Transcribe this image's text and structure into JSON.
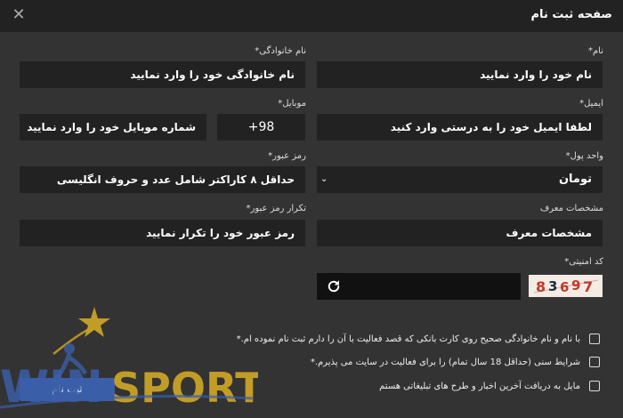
{
  "header": {
    "title": "صفحه ثبت نام",
    "close_icon": "close-icon"
  },
  "form": {
    "name": {
      "label": "نام*",
      "value": "نام خود را وارد نمایید"
    },
    "lastname": {
      "label": "نام خانوادگی*",
      "value": "نام خانوادگی خود را وارد نمایید"
    },
    "email": {
      "label": "ایمیل*",
      "value": "لطفا ایمیل خود را به درستی وارد کنید"
    },
    "mobile": {
      "label": "موبایل*",
      "code": "+98",
      "value": "شماره موبایل خود را وارد نمایید"
    },
    "currency": {
      "label": "واحد پول*",
      "value": "تومان"
    },
    "password": {
      "label": "رمز عبور*",
      "value": "حداقل ۸ کاراکتر شامل عدد و حروف انگلیسی"
    },
    "referrer": {
      "label": "مشخصات معرف",
      "value": "مشخصات معرف"
    },
    "password_confirm": {
      "label": "تکرار رمز عبور*",
      "value": "رمز عبور خود را تکرار نمایید"
    },
    "captcha": {
      "label": "کد امنیتی*",
      "code": "83697"
    }
  },
  "checkboxes": [
    "با نام و نام خانوادگی صحیح روی کارت بانکی که قصد فعالیت با آن را دارم ثبت نام نموده ام.*",
    "شرایط سنی (حداقل 18 سال تمام) را برای فعالیت در سایت می پذیرم.*",
    "مایل به دریافت آخرین اخبار و طرح های تبلیغاتی هستم"
  ],
  "submit_label": "ثبت نام",
  "logo": {
    "text_win": "WIN",
    "text_sport": "SPORT"
  },
  "colors": {
    "gold": "#c9a227",
    "blue": "#3b5ea8"
  }
}
